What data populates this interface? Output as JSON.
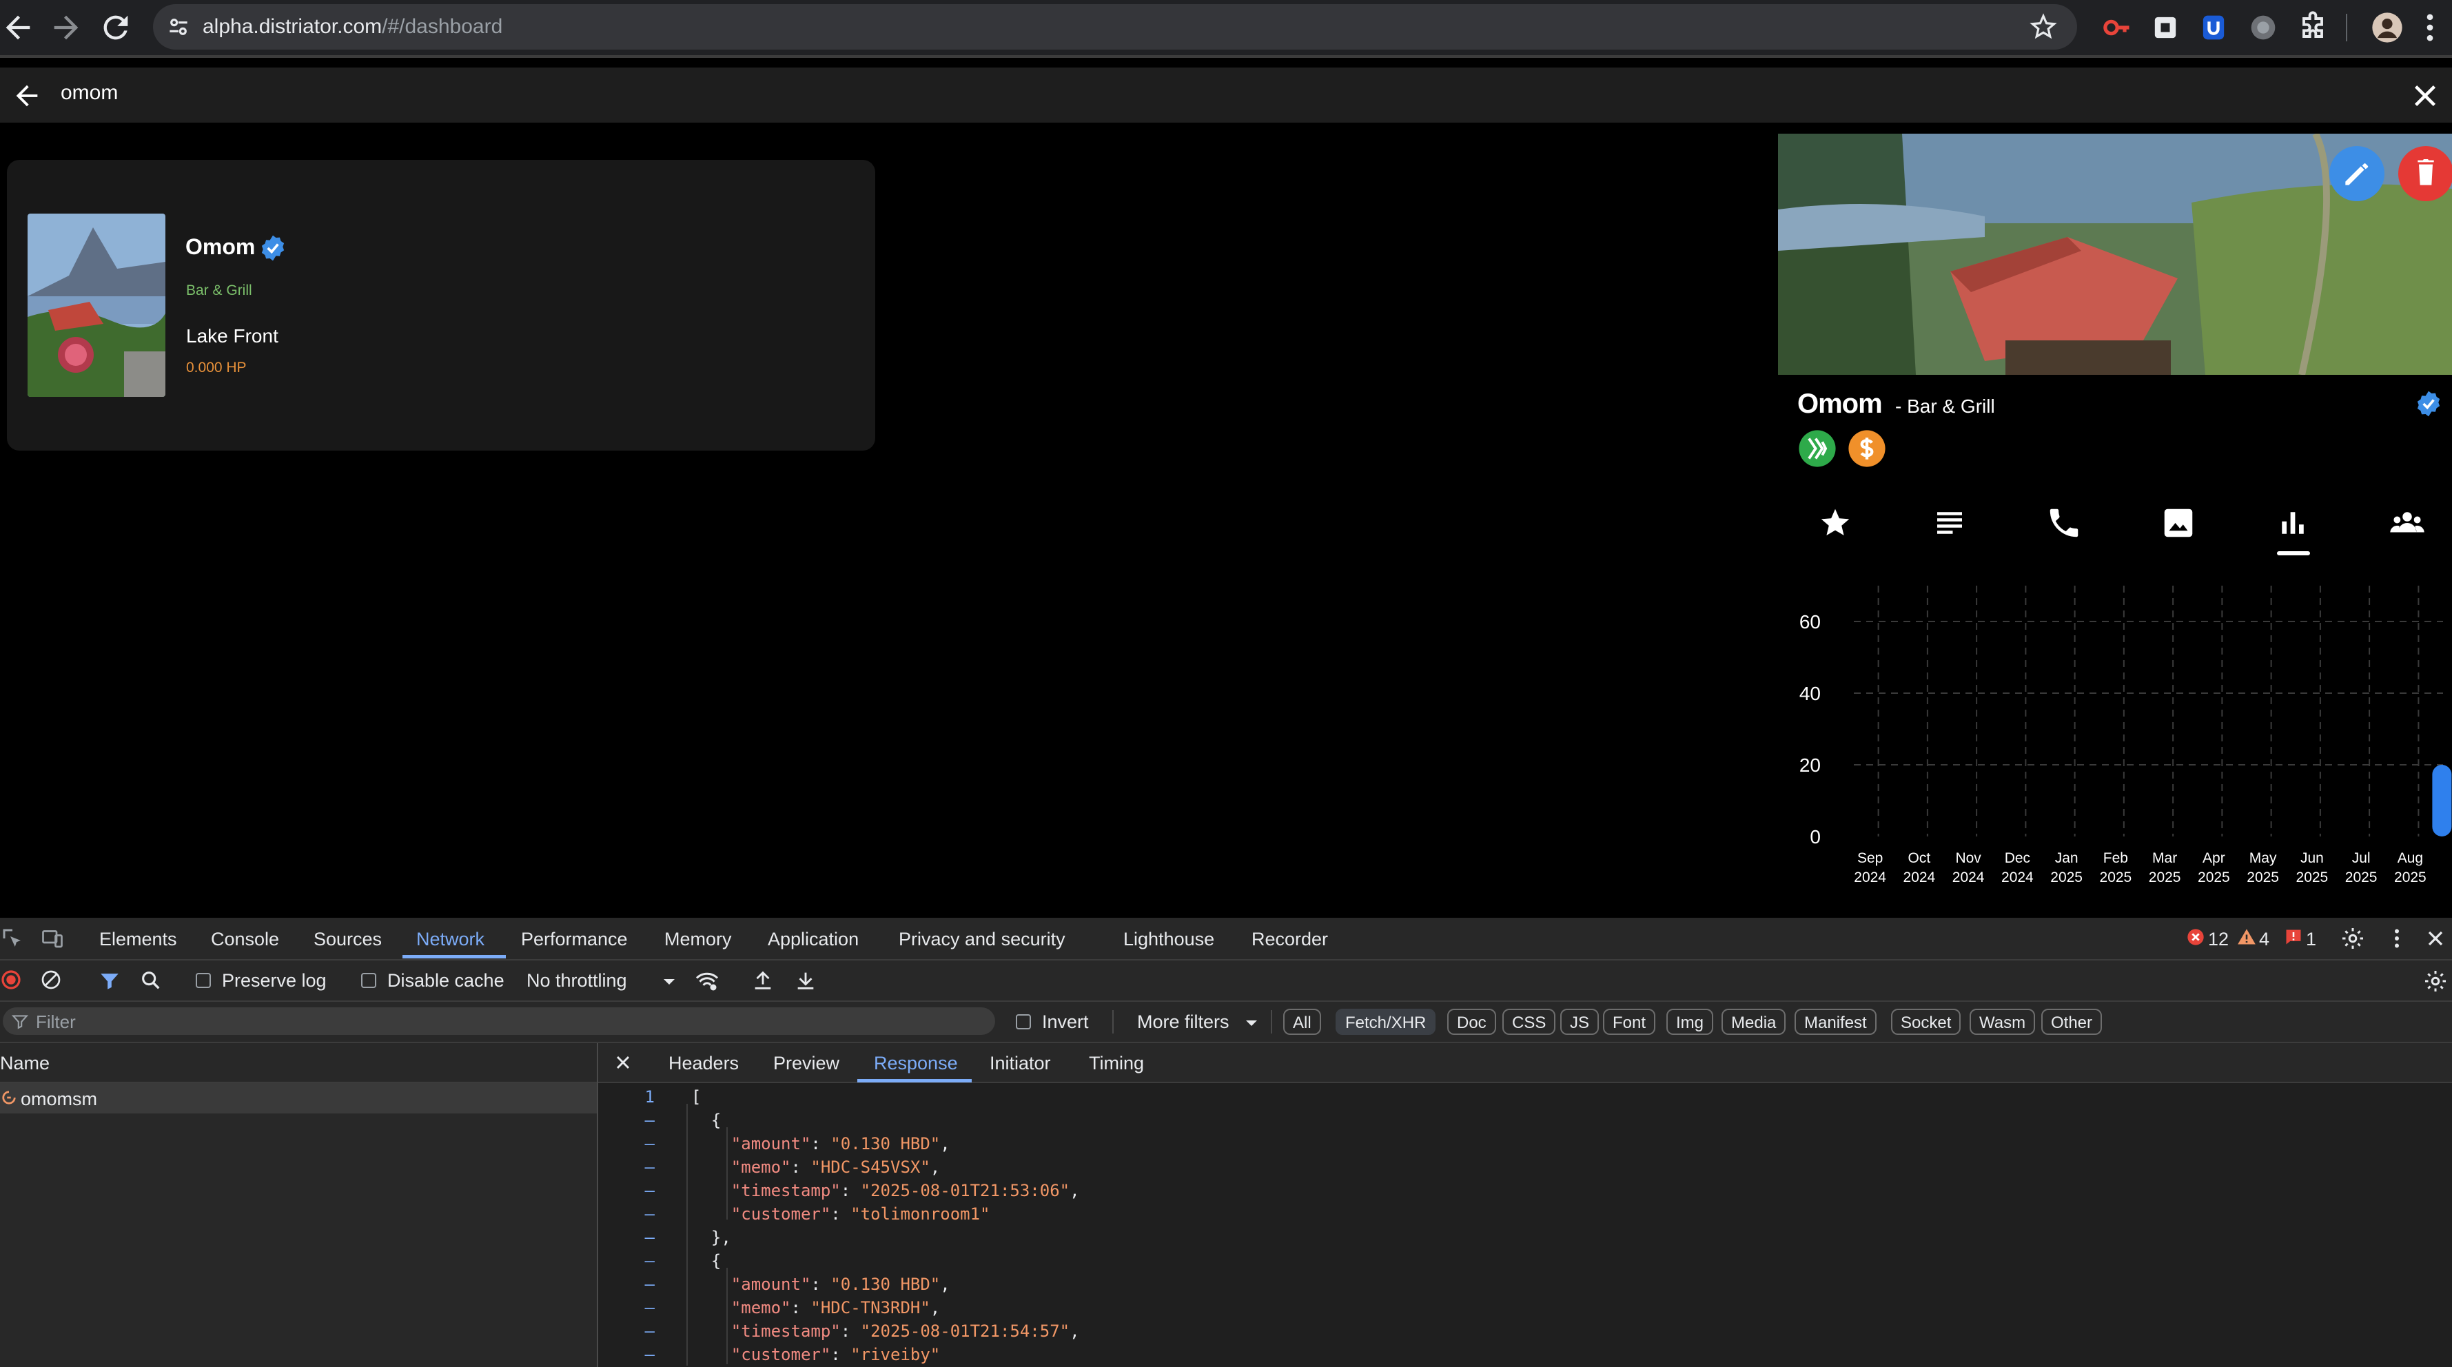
{
  "browser": {
    "url_host": "alpha.distriator.com",
    "url_path": "/#/dashboard",
    "icons": [
      "back-icon",
      "forward-icon",
      "reload-icon",
      "site-info-icon",
      "bookmark-star-icon",
      "extension-icons",
      "puzzle-icon",
      "profile-avatar",
      "menu-icon"
    ]
  },
  "search": {
    "value": "omom"
  },
  "result_card": {
    "name": "Omom",
    "category": "Bar & Grill",
    "location": "Lake Front",
    "hp": "0.000 HP"
  },
  "business_panel": {
    "name": "Omom",
    "category": "- Bar & Grill",
    "tabs": [
      "star-icon",
      "details-icon",
      "phone-icon",
      "gallery-icon",
      "stats-icon",
      "people-icon"
    ],
    "active_tab": "stats-icon",
    "colors": {
      "accent_blue": "#3d8ee6",
      "delete_red": "#e53935",
      "hive_green": "#2eaa4a",
      "hbd_orange": "#f0902a"
    }
  },
  "chart_data": {
    "type": "bar",
    "categories": [
      "Sep 2024",
      "Oct 2024",
      "Nov 2024",
      "Dec 2024",
      "Jan 2025",
      "Feb 2025",
      "Mar 2025",
      "Apr 2025",
      "May 2025",
      "Jun 2025",
      "Jul 2025",
      "Aug 2025"
    ],
    "category_lines": [
      [
        "Sep",
        "2024"
      ],
      [
        "Oct",
        "2024"
      ],
      [
        "Nov",
        "2024"
      ],
      [
        "Dec",
        "2024"
      ],
      [
        "Jan",
        "2025"
      ],
      [
        "Feb",
        "2025"
      ],
      [
        "Mar",
        "2025"
      ],
      [
        "Apr",
        "2025"
      ],
      [
        "May",
        "2025"
      ],
      [
        "Jun",
        "2025"
      ],
      [
        "Jul",
        "2025"
      ],
      [
        "Aug",
        "2025"
      ]
    ],
    "values": [
      0,
      0,
      0,
      0,
      0,
      0,
      0,
      0,
      0,
      0,
      0,
      20
    ],
    "yticks": [
      0,
      20,
      40,
      60
    ],
    "ylim": [
      0,
      60
    ],
    "grid": true,
    "bar_color": "#2f80ed"
  },
  "devtools": {
    "tabs": [
      "Elements",
      "Console",
      "Sources",
      "Network",
      "Performance",
      "Memory",
      "Application",
      "Privacy and security",
      "Lighthouse",
      "Recorder"
    ],
    "active_tab": "Network",
    "errors": "12",
    "warnings": "4",
    "issues": "1",
    "toolbar": {
      "preserve_log": "Preserve log",
      "disable_cache": "Disable cache",
      "throttling": "No throttling"
    },
    "filter": {
      "placeholder": "Filter",
      "invert": "Invert",
      "more_filters": "More filters",
      "types": [
        "All",
        "Fetch/XHR",
        "Doc",
        "CSS",
        "JS",
        "Font",
        "Img",
        "Media",
        "Manifest",
        "Socket",
        "Wasm",
        "Other"
      ],
      "selected_type": "Fetch/XHR"
    },
    "name_header": "Name",
    "requests": [
      "omomsm"
    ],
    "response_tabs": [
      "Headers",
      "Preview",
      "Response",
      "Initiator",
      "Timing"
    ],
    "active_response_tab": "Response",
    "response_lines": [
      {
        "n": "1",
        "t": "["
      },
      {
        "n": "–",
        "t": "  {"
      },
      {
        "n": "–",
        "key": "amount",
        "val": "0.130 HBD"
      },
      {
        "n": "–",
        "key": "memo",
        "val": "HDC-S45VSX"
      },
      {
        "n": "–",
        "key": "timestamp",
        "val": "2025-08-01T21:53:06"
      },
      {
        "n": "–",
        "key": "customer",
        "val": "tolimonroom1",
        "last": true
      },
      {
        "n": "–",
        "t": "  },"
      },
      {
        "n": "–",
        "t": "  {"
      },
      {
        "n": "–",
        "key": "amount",
        "val": "0.130 HBD"
      },
      {
        "n": "–",
        "key": "memo",
        "val": "HDC-TN3RDH"
      },
      {
        "n": "–",
        "key": "timestamp",
        "val": "2025-08-01T21:54:57"
      },
      {
        "n": "–",
        "key": "customer",
        "val": "riveiby",
        "last": true
      }
    ]
  }
}
